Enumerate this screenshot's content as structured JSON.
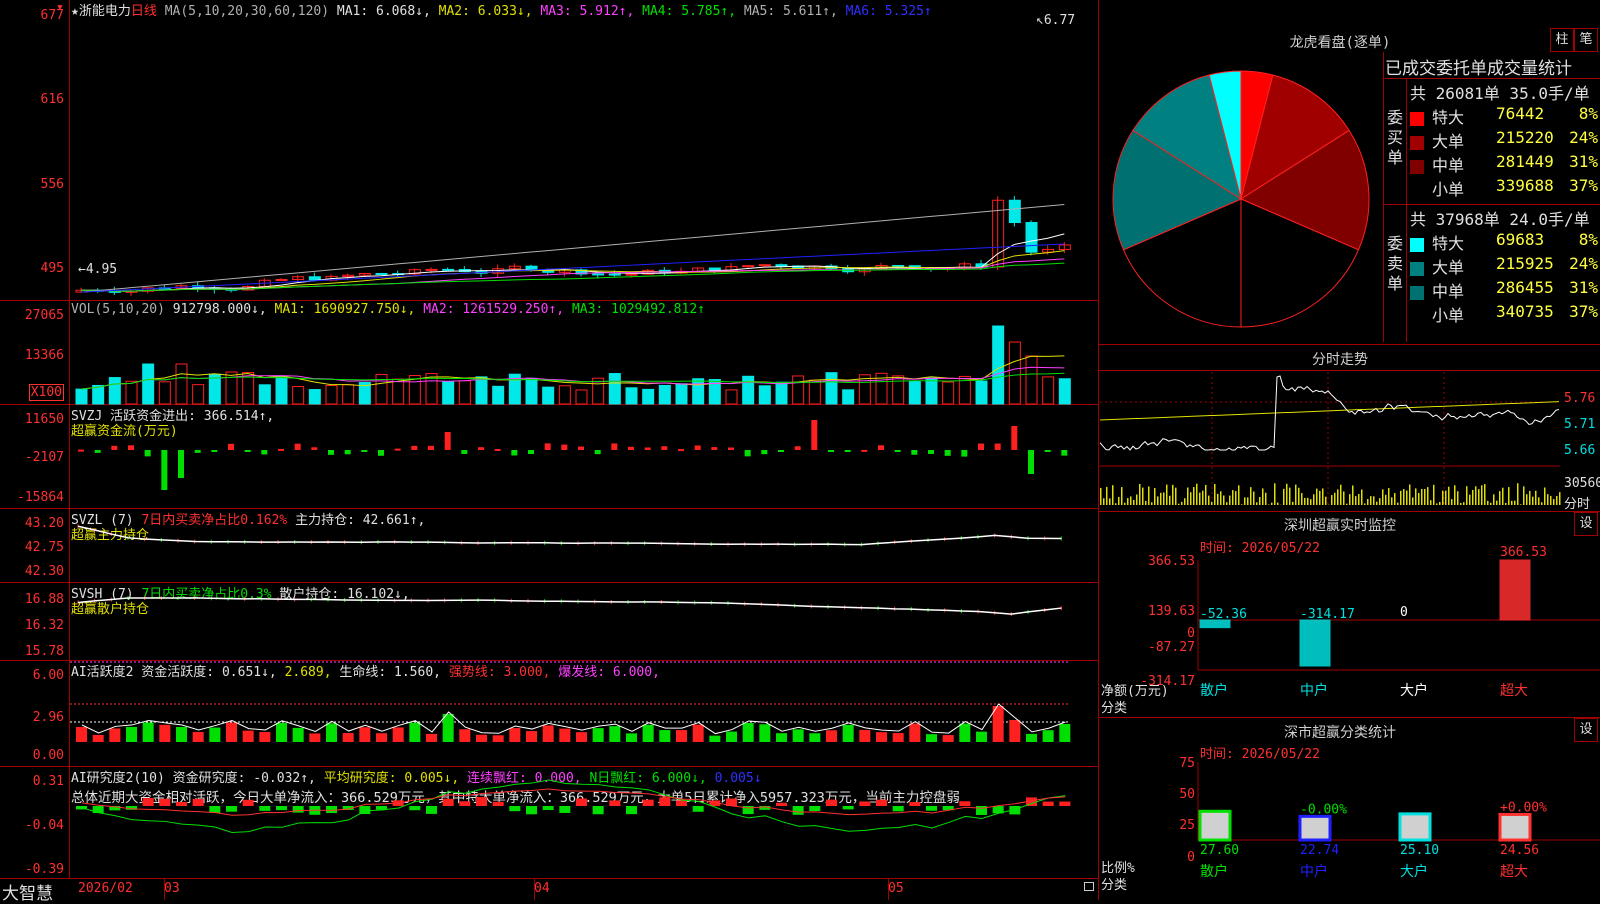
{
  "stock": {
    "star": "★",
    "name": "浙能电力",
    "period": "日线"
  },
  "main": {
    "ma_label": "MA(5,10,20,30,60,120)",
    "ma1": "MA1: 6.068↓,",
    "ma2": "MA2: 6.033↓,",
    "ma3": "MA3: 5.912↑,",
    "ma4": "MA4: 5.785↑,",
    "ma5": "MA5: 5.611↑,",
    "ma6": "MA6: 5.325↑",
    "y_ticks": [
      "677",
      "616",
      "556",
      "495"
    ],
    "high_mark": "6.77",
    "low_mark": "4.95",
    "colors": {
      "up": "#ff2020",
      "down": "#00e8e8",
      "ma1": "#ffffff",
      "ma2": "#e0e000",
      "ma3": "#ff40ff",
      "ma4": "#00e000",
      "ma5": "#b0b0b0",
      "ma6": "#2020ff"
    }
  },
  "vol": {
    "label": "VOL(5,10,20)",
    "val": "912798.000↓,",
    "ma1": "MA1: 1690927.750↓,",
    "ma2": "MA2: 1261529.250↑,",
    "ma3": "MA3: 1029492.812↑",
    "y_ticks": [
      "27065",
      "13366"
    ],
    "unit": "X100"
  },
  "svzj": {
    "label": "SVZJ",
    "desc": "活跃资金进出: 366.514↑,",
    "sub": "超赢资金流(万元)",
    "y_ticks": [
      "11650",
      "-2107",
      "-15864"
    ]
  },
  "svzl": {
    "label": "SVZL (7)",
    "desc_red": "7日内买卖净占比0.162%",
    "desc": "主力持仓: 42.661↑,",
    "sub": "超赢主力持仓",
    "y_ticks": [
      "43.20",
      "42.75",
      "42.30"
    ]
  },
  "svsh": {
    "label": "SVSH (7)",
    "desc_grn": "7日内买卖净占比0.3%",
    "desc": "散户持仓: 16.102↓,",
    "sub": "超赢散户持仓",
    "y_ticks": [
      "16.88",
      "16.32",
      "15.78"
    ]
  },
  "ai1": {
    "label": "AI活跃度2 资金活跃度: 0.651↓,",
    "v2": "2.689,",
    "life": "生命线: 1.560,",
    "strong": "强势线: 3.000,",
    "burst": "爆发线: 6.000,",
    "y_ticks": [
      "6.00",
      "2.96",
      "0.00"
    ]
  },
  "ai2": {
    "label": "AI研究度2(10) 资金研究度: -0.032↑,",
    "avg": "平均研究度: 0.005↓,",
    "cont": "连续飘红: 0.000,",
    "nday": "N日飘红: 6.000↓,",
    "v5": "0.005↓",
    "summary": "总体近期大资金相对活跃，今日大单净流入：366.529万元，其中特大单净流入：366.529万元，大单5日累计净入5957.323万元，当前主力控盘弱",
    "y_ticks": [
      "0.31",
      "-0.04",
      "-0.39"
    ]
  },
  "xaxis": {
    "logo": "大智慧",
    "labels": [
      "2026/02",
      "03",
      "04",
      "05"
    ]
  },
  "dragon": {
    "title": "龙虎看盘(逐单)",
    "btn1": "柱",
    "btn2": "笔",
    "table_title": "已成交委托单成交量统计",
    "buy_side": "委买单",
    "sell_side": "委卖单",
    "buy_total": "共 26081单 35.0手/单",
    "sell_total": "共 37968单 24.0手/单",
    "buy_rows": [
      {
        "name": "特大",
        "vol": "76442",
        "pct": "8%",
        "color": "#ff0000"
      },
      {
        "name": "大单",
        "vol": "215220",
        "pct": "24%",
        "color": "#a00000"
      },
      {
        "name": "中单",
        "vol": "281449",
        "pct": "31%",
        "color": "#800000"
      },
      {
        "name": "小单",
        "vol": "339688",
        "pct": "37%",
        "color": "#000000"
      }
    ],
    "sell_rows": [
      {
        "name": "特大",
        "vol": "69683",
        "pct": "8%",
        "color": "#00ffff"
      },
      {
        "name": "大单",
        "vol": "215925",
        "pct": "24%",
        "color": "#008080"
      },
      {
        "name": "中单",
        "vol": "286455",
        "pct": "31%",
        "color": "#007070"
      },
      {
        "name": "小单",
        "vol": "340735",
        "pct": "37%",
        "color": "#000000"
      }
    ],
    "pie": [
      {
        "v": 8,
        "color": "#ff0000"
      },
      {
        "v": 24,
        "color": "#a00000"
      },
      {
        "v": 31,
        "color": "#800000"
      },
      {
        "v": 37,
        "color": "#000000"
      },
      {
        "v": 37,
        "color": "#000000"
      },
      {
        "v": 31,
        "color": "#007070"
      },
      {
        "v": 24,
        "color": "#008080"
      },
      {
        "v": 8,
        "color": "#00ffff"
      }
    ]
  },
  "intraday": {
    "title": "分时走势",
    "prices": [
      "5.76",
      "5.71",
      "5.66"
    ],
    "vol": "30560",
    "vol_label": "分时"
  },
  "sz_monitor": {
    "title": "深圳超赢实时监控",
    "btn": "设",
    "time": "时间: 2026/05/22",
    "y_ticks": [
      "366.53",
      "139.63",
      "0",
      "-87.27",
      "-314.17"
    ],
    "y_caption1": "净额(万元)",
    "y_caption2": "分类",
    "bars": [
      {
        "cat": "散户",
        "value": -52.36,
        "label": "-52.36",
        "color": "#00e0e0"
      },
      {
        "cat": "中户",
        "value": -314.17,
        "label": "-314.17",
        "color": "#00e0e0"
      },
      {
        "cat": "大户",
        "value": 0,
        "label": "0",
        "color": "#ffffff"
      },
      {
        "cat": "超大",
        "value": 366.53,
        "label": "366.53",
        "color": "#ff3030"
      }
    ]
  },
  "sz_class": {
    "title": "深市超赢分类统计",
    "btn": "设",
    "time": "时间: 2026/05/22",
    "y_ticks": [
      "75",
      "50",
      "25",
      "0"
    ],
    "y_caption1": "比例%",
    "y_caption2": "分类",
    "bars": [
      {
        "cat": "散户",
        "value": 27.6,
        "label": "27.60",
        "delta": "",
        "color": "#00e000"
      },
      {
        "cat": "中户",
        "value": 22.74,
        "label": "22.74",
        "delta": "-0.00%",
        "color": "#2020ff"
      },
      {
        "cat": "大户",
        "value": 25.1,
        "label": "25.10",
        "delta": "",
        "color": "#00e0e0"
      },
      {
        "cat": "超大",
        "value": 24.56,
        "label": "24.56",
        "delta": "+0.00%",
        "color": "#ff3030"
      }
    ]
  }
}
